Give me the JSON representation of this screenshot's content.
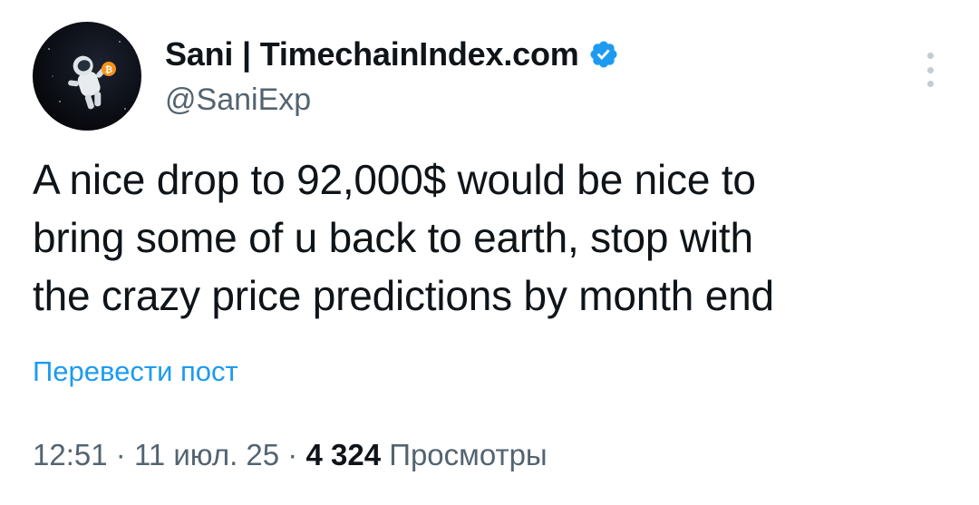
{
  "author": {
    "display_name": "Sani | TimechainIndex.com",
    "handle": "@SaniExp",
    "verified": true,
    "verified_badge_color": "#1d9bf0",
    "avatar_icon": "astronaut-with-bitcoin-avatar"
  },
  "tweet": {
    "lines": [
      "A nice drop to 92,000$ would be nice to",
      "bring some of u back to earth, stop with",
      "the crazy price predictions by month end"
    ],
    "translate_label": "Перевести пост"
  },
  "meta": {
    "time": "12:51",
    "separator": "·",
    "date": "11 июл. 25",
    "views_count": "4 324",
    "views_label": "Просмотры"
  },
  "colors": {
    "link": "#1d9bf0",
    "secondary_text": "#536471",
    "primary_text": "#0f1419"
  }
}
